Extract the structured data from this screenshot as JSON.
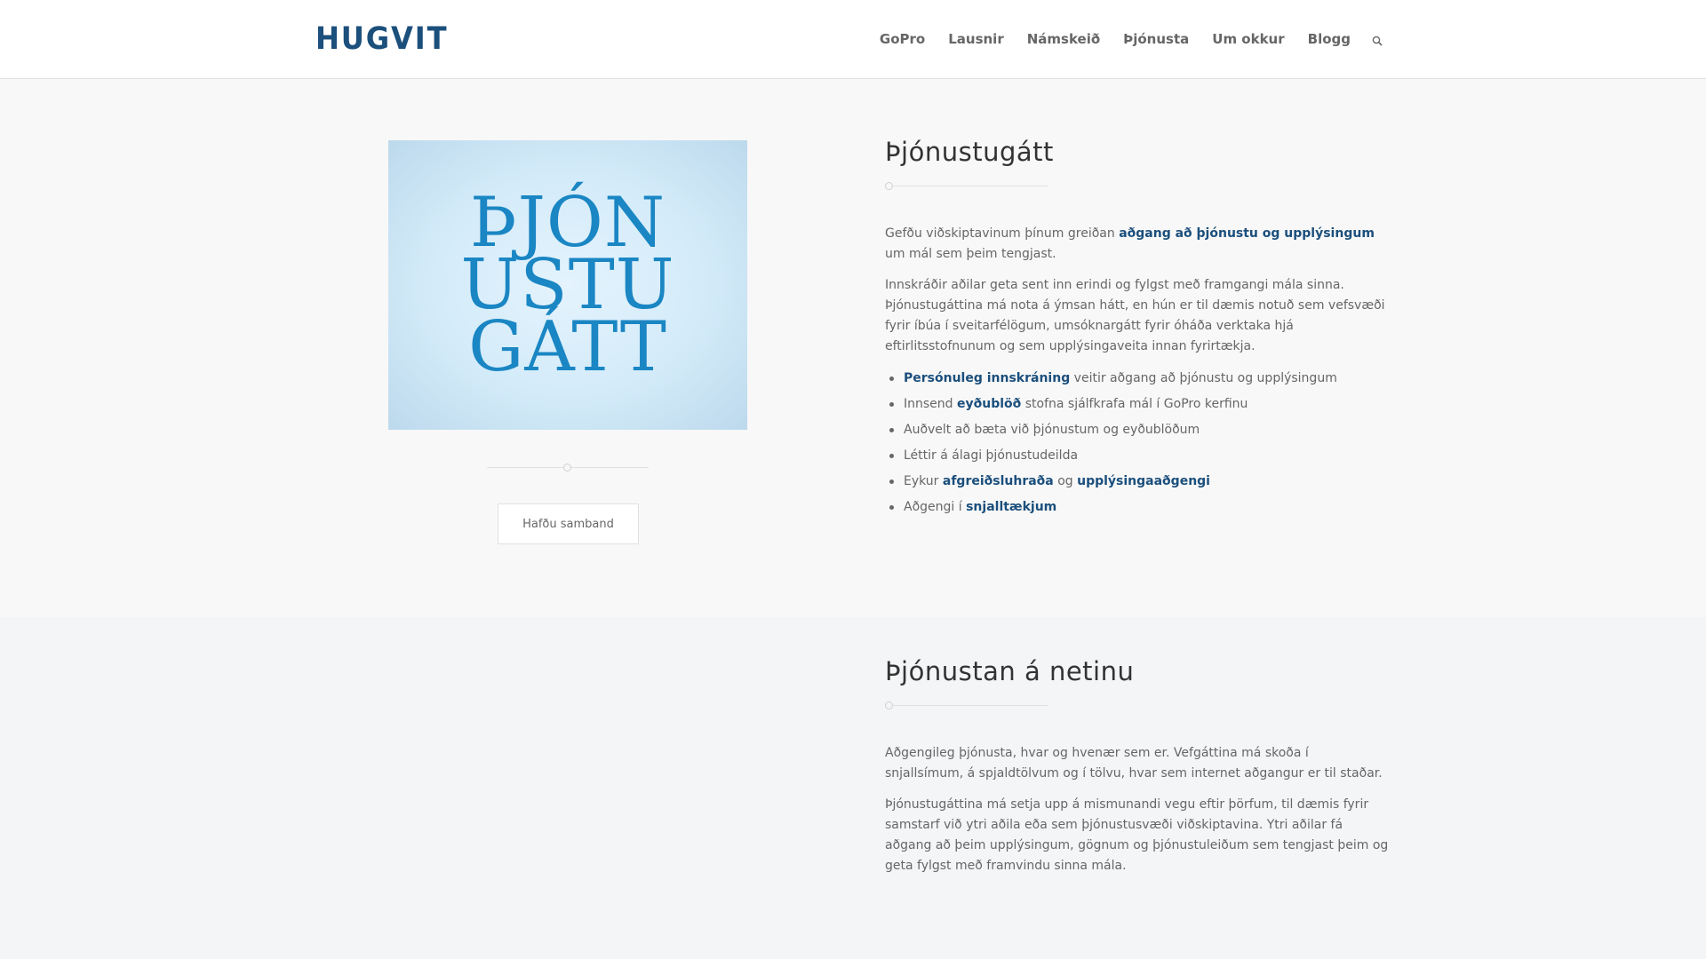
{
  "header": {
    "logo": "HUGVIT",
    "nav": [
      "GoPro",
      "Lausnir",
      "Námskeið",
      "Þjónusta",
      "Um okkur",
      "Blogg"
    ],
    "search_icon": "search-icon"
  },
  "section1": {
    "image_lines": [
      "ÞJÓN",
      "USTU",
      "GÁTT"
    ],
    "contact_button": "Hafðu samband",
    "title": "Þjónustugátt",
    "p1": {
      "pre": "Gefðu viðskiptavinum þínum greiðan ",
      "strong": "aðgang að þjónustu og upplýsingum",
      "post": " um mál sem þeim tengjast."
    },
    "p2": "Innskráðir aðilar geta sent inn erindi og fylgst með framgangi mála sinna. Þjónustugáttina má nota á ýmsan hátt, en hún er til dæmis notuð sem vefsvæði fyrir íbúa í sveitarfélögum, umsóknargátt fyrir óháða verktaka hjá eftirlitsstofnunum og sem upplýsingaveita innan fyrirtækja.",
    "list": {
      "i1_strong": "Persónuleg innskráning",
      "i1_post": " veitir aðgang að þjónustu og upplýsingum",
      "i2_pre": "Innsend ",
      "i2_strong": "eyðublöð",
      "i2_post": " stofna sjálfkrafa mál í GoPro kerfinu",
      "i3": "Auðvelt að bæta við þjónustum og eyðublöðum",
      "i4": "Léttir á álagi þjónustudeilda",
      "i5_pre": "Eykur ",
      "i5_strong1": "afgreiðsluhraða",
      "i5_mid": " og ",
      "i5_strong2": "upplýsingaaðgengi",
      "i6_pre": "Aðgengi í ",
      "i6_strong": "snjalltækjum"
    }
  },
  "section2": {
    "title": "Þjónustan á netinu",
    "p1": "Aðgengileg þjónusta, hvar og hvenær sem er. Vefgáttina má skoða í snjallsímum, á spjaldtölvum og í tölvu, hvar sem internet aðgangur er til staðar.",
    "p2": "Þjónustugáttina má setja upp á mismunandi vegu eftir þörfum, til dæmis fyrir samstarf við ytri aðila eða sem þjónustusvæði viðskiptavina. Ytri aðilar fá aðgang að þeim upplýsingum, gögnum og þjónustuleiðum sem tengjast þeim og geta fylgst með framvindu sinna mála."
  },
  "side_arrows": {
    "left": "‹",
    "right": "›"
  },
  "colors": {
    "brand": "#1b4f7c",
    "image_text": "#1a86c3"
  }
}
